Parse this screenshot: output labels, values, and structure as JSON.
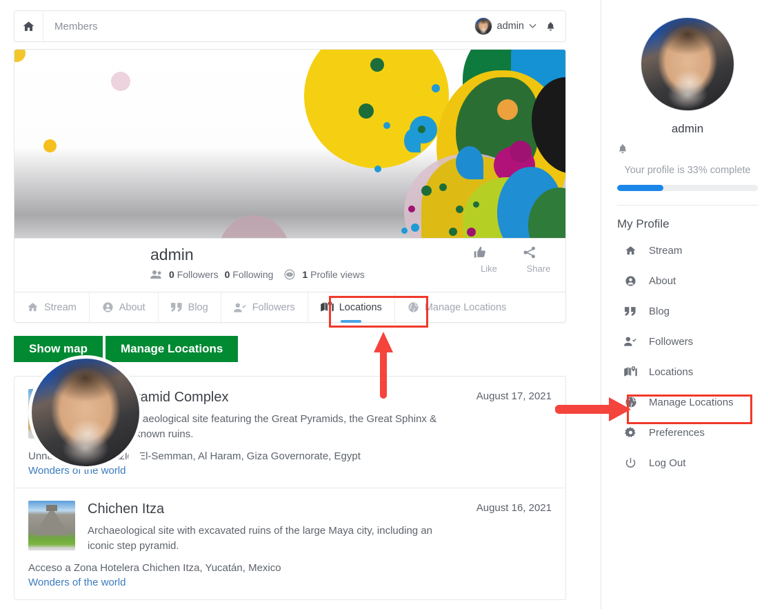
{
  "topbar": {
    "home_icon": "home-icon",
    "title": "Members",
    "username": "admin",
    "caret_icon": "chevron-down-icon",
    "bell_icon": "bell-icon"
  },
  "profile": {
    "name": "admin",
    "people_icon": "people-icon",
    "followers_count": "0",
    "followers_label": "Followers",
    "following_count": "0",
    "following_label": "Following",
    "eye_icon": "eye-icon",
    "views_count": "1",
    "views_label": "Profile views",
    "like_icon": "thumbs-up-icon",
    "like_label": "Like",
    "share_icon": "share-icon",
    "share_label": "Share"
  },
  "tabs": [
    {
      "label": "Stream",
      "icon": "home-icon",
      "active": false
    },
    {
      "label": "About",
      "icon": "user-circle-icon",
      "active": false
    },
    {
      "label": "Blog",
      "icon": "quote-icon",
      "active": false
    },
    {
      "label": "Followers",
      "icon": "user-check-icon",
      "active": false
    },
    {
      "label": "Locations",
      "icon": "map-marker-icon",
      "active": true
    },
    {
      "label": "Manage Locations",
      "icon": "globe-icon",
      "active": false
    }
  ],
  "buttons": {
    "show_map": "Show map",
    "manage_locations": "Manage Locations",
    "green": "#028a33"
  },
  "locations": [
    {
      "title": "Giza Pyramid Complex",
      "date": "August 17, 2021",
      "description": "Famed archaeological site featuring the Great Pyramids, the Great Sphinx & other well-known ruins.",
      "address": "Unnamed Road, Nazlet El-Semman, Al Haram, Giza Governorate, Egypt",
      "link": "Wonders of the world",
      "thumb": "pyramids-photo"
    },
    {
      "title": "Chichen Itza",
      "date": "August 16, 2021",
      "description": "Archaeological site with excavated ruins of the large Maya city, including an iconic step pyramid.",
      "address": "Acceso a Zona Hotelera Chichen Itza, Yucatán, Mexico",
      "link": "Wonders of the world",
      "thumb": "chichen-itza-photo"
    }
  ],
  "sidebar": {
    "avatar": "user-avatar-photo",
    "name": "admin",
    "bell_icon": "bell-icon",
    "completion_text": "Your profile is 33% complete",
    "completion_percent": 33,
    "progress_color": "#1c87e8",
    "heading": "My Profile",
    "items": [
      {
        "label": "Stream",
        "icon": "home-icon",
        "highlighted": false
      },
      {
        "label": "About",
        "icon": "user-circle-icon",
        "highlighted": false
      },
      {
        "label": "Blog",
        "icon": "quote-icon",
        "highlighted": false
      },
      {
        "label": "Followers",
        "icon": "user-check-icon",
        "highlighted": false
      },
      {
        "label": "Locations",
        "icon": "map-marker-icon",
        "highlighted": true
      },
      {
        "label": "Manage Locations",
        "icon": "globe-icon",
        "highlighted": false
      },
      {
        "label": "Preferences",
        "icon": "gear-icon",
        "highlighted": false
      },
      {
        "label": "Log Out",
        "icon": "power-icon",
        "highlighted": false
      }
    ]
  },
  "annotations": {
    "color": "#f0392b",
    "arrow_up_target": "Locations tab",
    "arrow_right_target": "Locations sidebar item"
  }
}
